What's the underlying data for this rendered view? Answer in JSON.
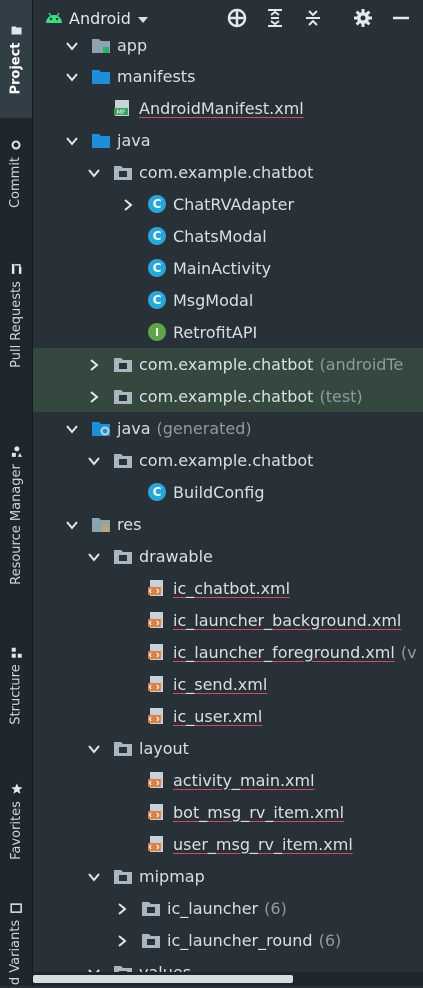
{
  "side_tabs": [
    {
      "label": "Project",
      "icon": "folder-icon",
      "active": true
    },
    {
      "label": "Commit",
      "icon": "commit-icon",
      "active": false
    },
    {
      "label": "Pull Requests",
      "icon": "pull-request-icon",
      "active": false
    },
    {
      "label": "Resource Manager",
      "icon": "resource-manager-icon",
      "active": false
    },
    {
      "label": "Structure",
      "icon": "structure-icon",
      "active": false
    },
    {
      "label": "Favorites",
      "icon": "star-icon",
      "active": false
    },
    {
      "label": "d Variants",
      "icon": "build-variants-icon",
      "active": false
    }
  ],
  "toolbar": {
    "title": "Android",
    "icons": [
      "locate-icon",
      "expand-all-icon",
      "collapse-all-icon",
      "gear-icon",
      "minimize-icon"
    ]
  },
  "tree": [
    {
      "label": "app",
      "icon": "module",
      "arrow": "down"
    },
    {
      "label": "manifests",
      "icon": "folder",
      "arrow": "down"
    },
    {
      "label": "AndroidManifest.xml",
      "icon": "manifest",
      "arrow": "none"
    },
    {
      "label": "java",
      "icon": "folder",
      "arrow": "down"
    },
    {
      "label": "com.example.chatbot",
      "icon": "package",
      "arrow": "down"
    },
    {
      "label": "ChatRVAdapter",
      "icon": "class",
      "arrow": "right"
    },
    {
      "label": "ChatsModal",
      "icon": "class",
      "arrow": "none"
    },
    {
      "label": "MainActivity",
      "icon": "class",
      "arrow": "none"
    },
    {
      "label": "MsgModal",
      "icon": "class",
      "arrow": "none"
    },
    {
      "label": "RetrofitAPI",
      "icon": "interface",
      "arrow": "none"
    },
    {
      "label": "com.example.chatbot",
      "extra": "(androidTe",
      "icon": "package",
      "arrow": "right",
      "highlight": true
    },
    {
      "label": "com.example.chatbot",
      "extra": "(test)",
      "icon": "package",
      "arrow": "right",
      "highlight": true
    },
    {
      "label": "java",
      "extra": "(generated)",
      "icon": "gen-folder",
      "arrow": "down"
    },
    {
      "label": "com.example.chatbot",
      "icon": "package",
      "arrow": "down"
    },
    {
      "label": "BuildConfig",
      "icon": "class",
      "arrow": "none"
    },
    {
      "label": "res",
      "icon": "res-folder",
      "arrow": "down"
    },
    {
      "label": "drawable",
      "icon": "package",
      "arrow": "down"
    },
    {
      "label": "ic_chatbot.xml",
      "icon": "xml",
      "arrow": "none"
    },
    {
      "label": "ic_launcher_background.xml",
      "icon": "xml",
      "arrow": "none"
    },
    {
      "label": "ic_launcher_foreground.xml",
      "extra": "(v",
      "icon": "xml",
      "arrow": "none"
    },
    {
      "label": "ic_send.xml",
      "icon": "xml",
      "arrow": "none"
    },
    {
      "label": "ic_user.xml",
      "icon": "xml",
      "arrow": "none"
    },
    {
      "label": "layout",
      "icon": "package",
      "arrow": "down"
    },
    {
      "label": "activity_main.xml",
      "icon": "xml",
      "arrow": "none"
    },
    {
      "label": "bot_msg_rv_item.xml",
      "icon": "xml",
      "arrow": "none"
    },
    {
      "label": "user_msg_rv_item.xml",
      "icon": "xml",
      "arrow": "none"
    },
    {
      "label": "mipmap",
      "icon": "package",
      "arrow": "down"
    },
    {
      "label": "ic_launcher",
      "extra": "(6)",
      "icon": "package",
      "arrow": "right"
    },
    {
      "label": "ic_launcher_round",
      "extra": "(6)",
      "icon": "package",
      "arrow": "right"
    },
    {
      "label": "values",
      "icon": "package",
      "arrow": "down"
    }
  ],
  "colors": {
    "background": "#273137",
    "class_icon": "#2aa7d6",
    "interface_icon": "#5da548",
    "folder": "#1c8fd9",
    "xml_icon": "#d8804a",
    "selection": "#34483f"
  }
}
